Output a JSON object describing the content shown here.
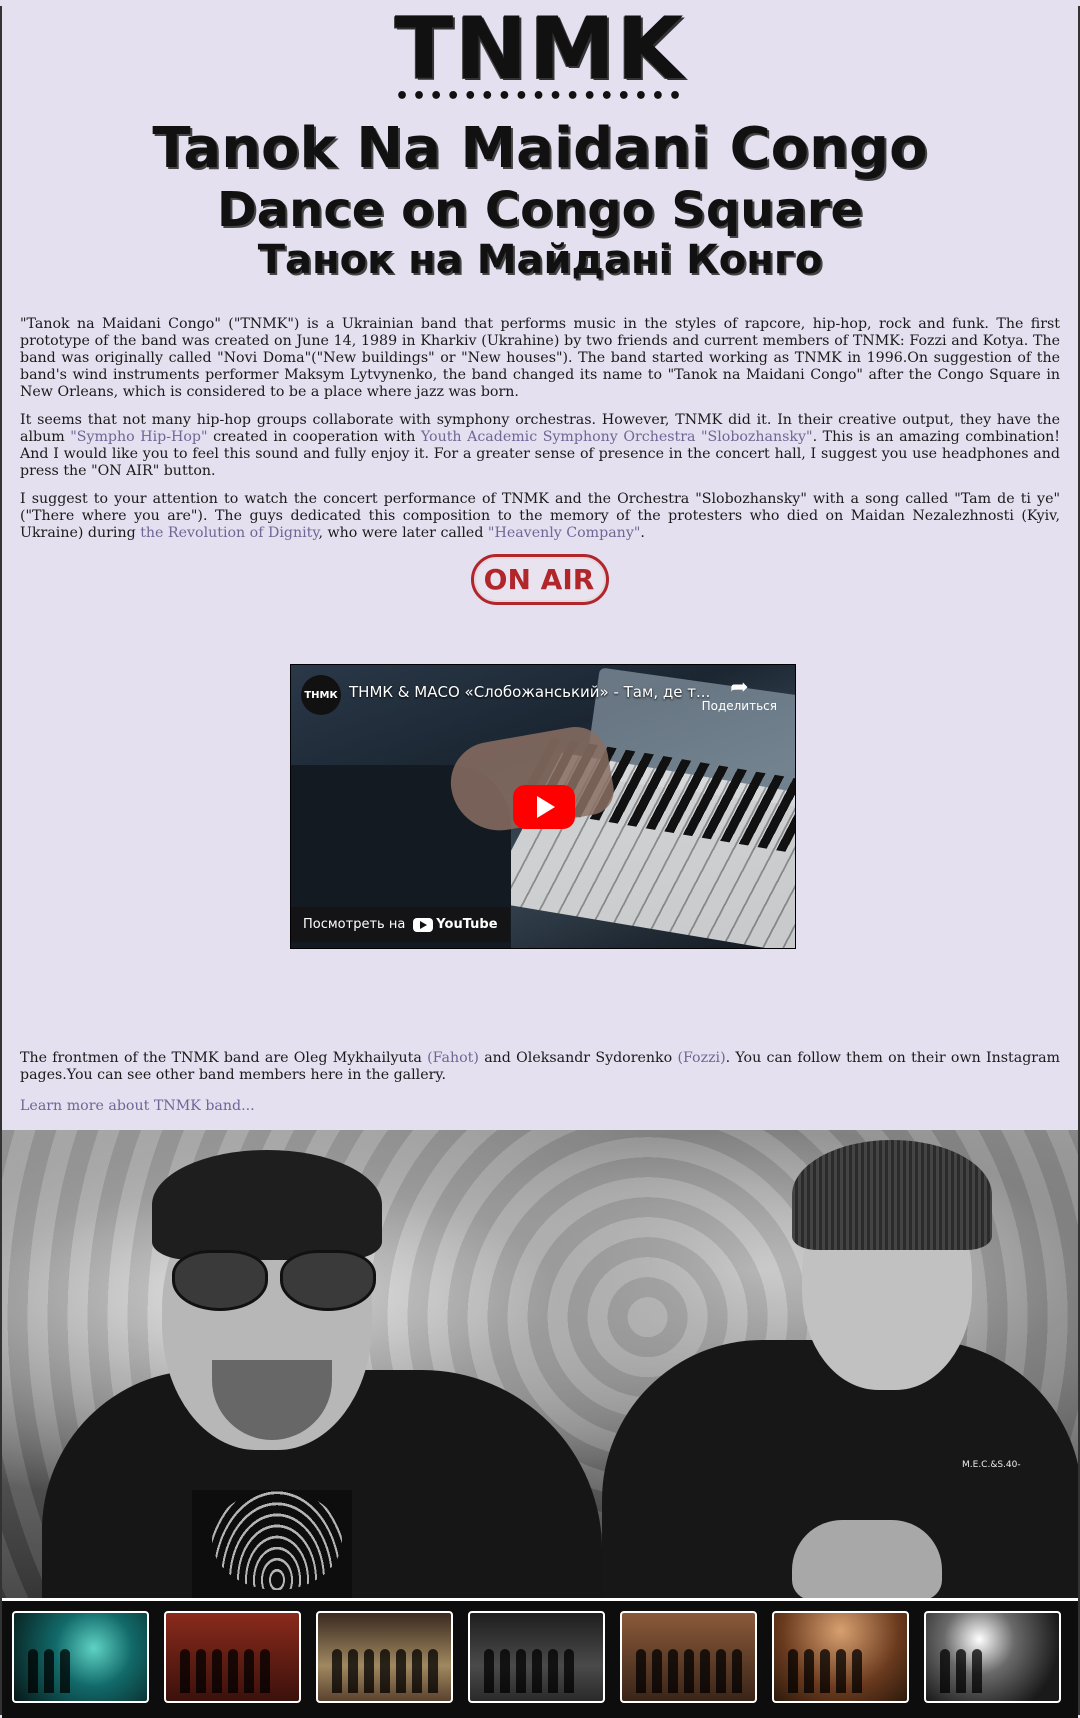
{
  "header": {
    "logo": "TNMK",
    "logo_dots": "•••••••••••••••••",
    "title_latin": "Tanok Na Maidani Congo",
    "title_english": "Dance on Congo Square",
    "title_ukrainian": "Танок на Майдані Конго"
  },
  "intro": {
    "p1": "\"Tanok na Maidani Congo\" (\"TNMK\") is a Ukrainian band that performs music in the styles of rapcore, hip-hop, rock and funk. The first prototype of the band was created on June 14, 1989 in Kharkiv (Ukrahine) by two friends and current members of TNMK: Fozzi and Kotya. The band was originally called \"Novi Doma\"(\"New buildings\" or \"New houses\"). The band started working as TNMK in 1996.On suggestion of the band's wind instruments performer Maksym Lytvynenko, the band changed its name to \"Tanok na Maidani Congo\" after the Congo Square in New Orleans, which is considered to be a place where jazz was born.",
    "p2_a": "It seems that not many hip-hop groups collaborate with symphony orchestras. However, TNMK did it. In their creative output, they have the album ",
    "p2_link1": "\"Sympho Hip-Hop\"",
    "p2_b": " created in cooperation with ",
    "p2_link2": "Youth Academic Symphony Orchestra \"Slobozhansky\"",
    "p2_c": ". This is an amazing combination! And I would like you to feel this sound and fully enjoy it. For a greater sense of presence in the concert hall, I suggest you use headphones and press the \"ON AIR\" button.",
    "p3_a": "I suggest to your attention to watch the concert performance of TNMK and the Orchestra \"Slobozhansky\" with a song called \"Tam de ti ye\"(\"There where you are\"). The guys dedicated this composition to the memory of the protesters who died on Maidan Nezalezhnosti (Kyiv, Ukraine) during ",
    "p3_link1": "the Revolution of Dignity",
    "p3_b": ", who were later called ",
    "p3_link2": "\"Heavenly Company\"",
    "p3_c": "."
  },
  "on_air_button": "ON AIR",
  "video": {
    "channel_avatar": "ТНМК",
    "title": "ТНМК & МАСО «Слобожанський» - Там, де т...",
    "share_label": "Поделиться",
    "watch_on": "Посмотреть на",
    "youtube": "YouTube"
  },
  "frontmen": {
    "text_a": "The frontmen of the TNMK band are Oleg Mykhailyuta ",
    "link1": "(Fahot)",
    "text_b": " and Oleksandr Sydorenko ",
    "link2": "(Fozzi)",
    "text_c": ". You can follow them on their own Instagram pages.You can see other band members here in the gallery.",
    "learn_more": "Learn more about TNMK band..."
  },
  "photo_badge": "M.E.C.&S.40-",
  "gallery": {
    "thumbnail_count": 7
  },
  "colors": {
    "background": "#e4e0ef",
    "link": "#6e6796",
    "on_air": "#b0262b"
  }
}
